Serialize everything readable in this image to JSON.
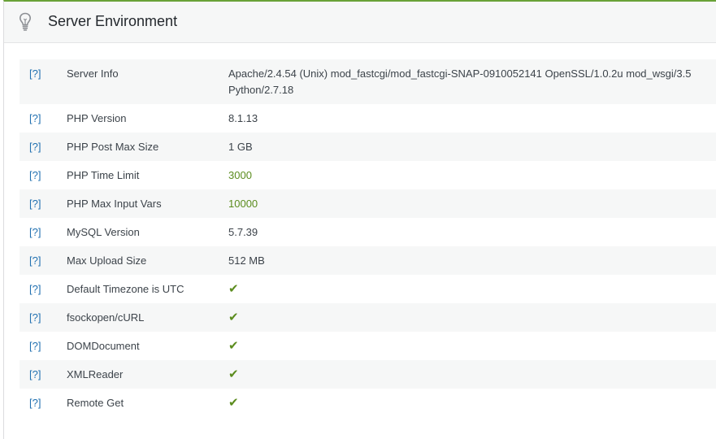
{
  "panel": {
    "title": "Server Environment",
    "icon": "lightbulb-icon",
    "accent_color": "#69a237"
  },
  "help_label": "[?]",
  "check_glyph": "✔",
  "rows": [
    {
      "label": "Server Info",
      "value": "Apache/2.4.54 (Unix) mod_fastcgi/mod_fastcgi-SNAP-0910052141 OpenSSL/1.0.2u mod_wsgi/3.5 Python/2.7.18",
      "status": "text"
    },
    {
      "label": "PHP Version",
      "value": "8.1.13",
      "status": "text"
    },
    {
      "label": "PHP Post Max Size",
      "value": "1 GB",
      "status": "text"
    },
    {
      "label": "PHP Time Limit",
      "value": "3000",
      "status": "good"
    },
    {
      "label": "PHP Max Input Vars",
      "value": "10000",
      "status": "good"
    },
    {
      "label": "MySQL Version",
      "value": "5.7.39",
      "status": "text"
    },
    {
      "label": "Max Upload Size",
      "value": "512 MB",
      "status": "text"
    },
    {
      "label": "Default Timezone is UTC",
      "value": "✔",
      "status": "check"
    },
    {
      "label": "fsockopen/cURL",
      "value": "✔",
      "status": "check"
    },
    {
      "label": "DOMDocument",
      "value": "✔",
      "status": "check"
    },
    {
      "label": "XMLReader",
      "value": "✔",
      "status": "check"
    },
    {
      "label": "Remote Get",
      "value": "✔",
      "status": "check"
    }
  ]
}
